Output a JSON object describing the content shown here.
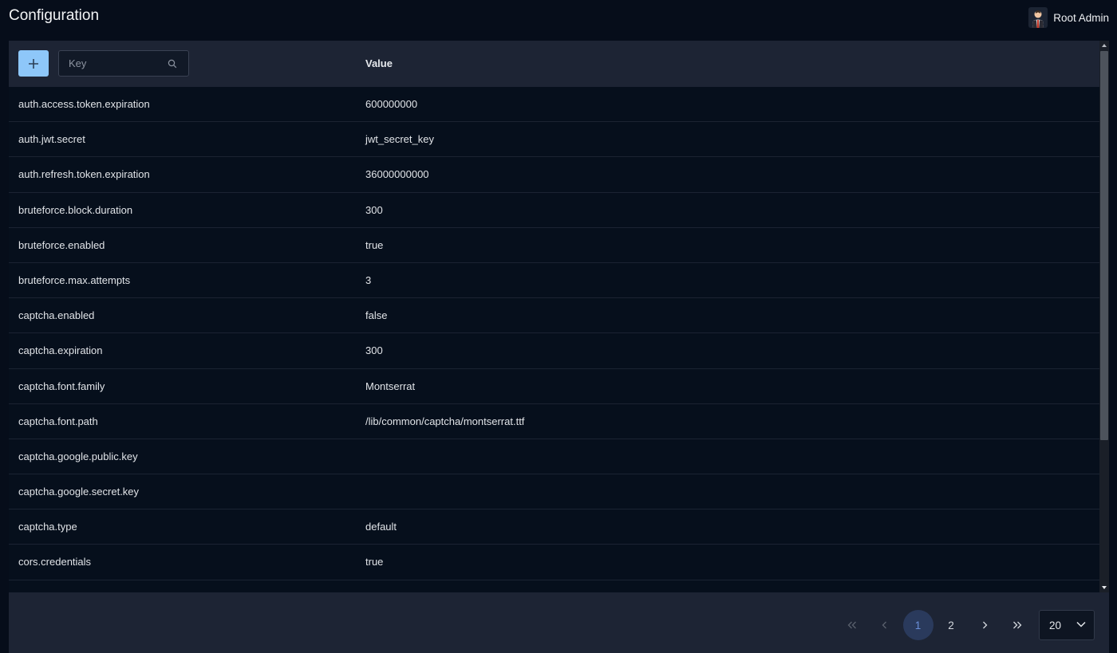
{
  "header": {
    "title": "Configuration",
    "user_name": "Root Admin"
  },
  "table": {
    "search_placeholder": "Key",
    "value_header": "Value",
    "rows": [
      {
        "key": "auth.access.token.expiration",
        "value": "600000000"
      },
      {
        "key": "auth.jwt.secret",
        "value": "jwt_secret_key"
      },
      {
        "key": "auth.refresh.token.expiration",
        "value": "36000000000"
      },
      {
        "key": "bruteforce.block.duration",
        "value": "300"
      },
      {
        "key": "bruteforce.enabled",
        "value": "true"
      },
      {
        "key": "bruteforce.max.attempts",
        "value": "3"
      },
      {
        "key": "captcha.enabled",
        "value": "false"
      },
      {
        "key": "captcha.expiration",
        "value": "300"
      },
      {
        "key": "captcha.font.family",
        "value": "Montserrat"
      },
      {
        "key": "captcha.font.path",
        "value": "/lib/common/captcha/montserrat.ttf"
      },
      {
        "key": "captcha.google.public.key",
        "value": ""
      },
      {
        "key": "captcha.google.secret.key",
        "value": ""
      },
      {
        "key": "captcha.type",
        "value": "default"
      },
      {
        "key": "cors.credentials",
        "value": "true"
      }
    ]
  },
  "pagination": {
    "first_icon": "double-chevron-left-icon",
    "prev_icon": "chevron-left-icon",
    "pages": [
      "1",
      "2"
    ],
    "current_page": "1",
    "next_icon": "chevron-right-icon",
    "last_icon": "double-chevron-right-icon",
    "page_size": "20"
  },
  "colors": {
    "background": "#060d1a",
    "header_bar": "#1d2434",
    "accent_button": "#8ec7f9",
    "active_page": "#2a3a5c"
  }
}
